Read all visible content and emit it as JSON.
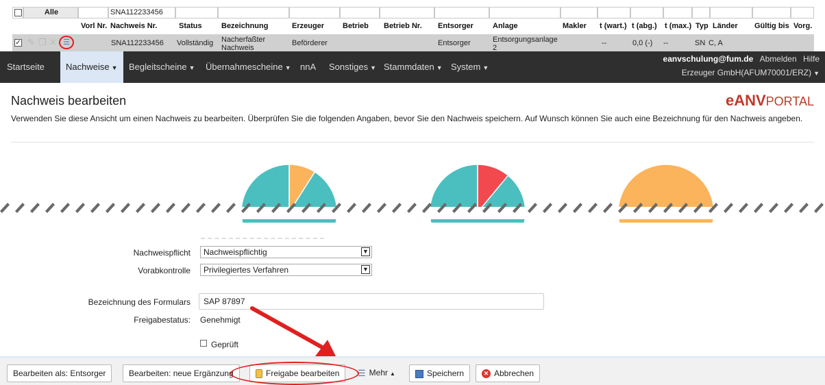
{
  "table": {
    "filter_row": {
      "alle_label": "Alle",
      "nachweis_filter": "SNA112233456"
    },
    "headers": [
      "Vorl Nr.",
      "Nachweis Nr.",
      "Status",
      "Bezeichnung",
      "Erzeuger",
      "Betrieb",
      "Betrieb Nr.",
      "Entsorger",
      "Anlage",
      "Makler",
      "t (wart.)",
      "t (abg.)",
      "t (max.)",
      "Typ",
      "Länder",
      "Gültig bis",
      "Vorg."
    ],
    "row": {
      "nachweis_nr": "SNA112233456",
      "status": "Vollständig",
      "bezeichnung": "Nacherfaßter Nachweis",
      "erzeuger": "Beförderer",
      "entsorger": "Entsorger",
      "anlage": "Entsorgungsanlage 2",
      "t_wart": "--",
      "t_abg": "0,0 (-)",
      "t_max": "--",
      "typ": "SN",
      "laender": "C, A"
    }
  },
  "nav": {
    "items": [
      {
        "label": "Startseite"
      },
      {
        "label": "Nachweise",
        "active": true
      },
      {
        "label": "Begleitscheine"
      },
      {
        "label": "Übernahmescheine"
      },
      {
        "label": "nnA"
      },
      {
        "label": "Sonstiges"
      },
      {
        "label": "Stammdaten"
      },
      {
        "label": "System"
      }
    ],
    "user_email": "eanvschulung@fum.de",
    "logout": "Abmelden",
    "help": "Hilfe",
    "company": "Erzeuger GmbH(AFUM70001/ERZ)"
  },
  "page": {
    "title": "Nachweis bearbeiten",
    "logo_bold": "eANV",
    "logo_thin": "PORTAL",
    "description": "Verwenden Sie diese Ansicht um einen Nachweis zu bearbeiten. Überprüfen Sie die folgenden Angaben, bevor Sie den Nachweis speichern. Auf Wunsch können Sie auch eine Bezeichnung für den Nachweis angeben."
  },
  "charts": {
    "colors": {
      "teal": "#4bbfbf",
      "orange": "#fbb45c",
      "red": "#f2494f"
    },
    "pies": [
      {
        "slices": [
          {
            "color": "orange",
            "fraction": 0.09
          },
          {
            "color": "teal",
            "fraction": 0.91
          }
        ]
      },
      {
        "slices": [
          {
            "color": "red",
            "fraction": 0.11
          },
          {
            "color": "teal",
            "fraction": 0.89
          }
        ]
      },
      {
        "slices": [
          {
            "color": "orange",
            "fraction": 1.0
          }
        ]
      }
    ]
  },
  "form": {
    "nachweispflicht_label": "Nachweispflicht",
    "nachweispflicht_value": "Nachweispflichtig",
    "vorabkontrolle_label": "Vorabkontrolle",
    "vorabkontrolle_value": "Privilegiertes Verfahren",
    "bezeichnung_label": "Bezeichnung des Formulars",
    "bezeichnung_value": "SAP 87897",
    "freigabestatus_label": "Freigabestatus:",
    "freigabestatus_value": "Genehmigt",
    "geprueft_label": "Geprüft",
    "geprueft_checked": false
  },
  "toolbar": {
    "edit_as": "Bearbeiten als: Entsorger",
    "edit_new": "Bearbeiten: neue Ergänzung",
    "freigabe": "Freigabe bearbeiten",
    "mehr": "Mehr",
    "speichern": "Speichern",
    "abbrechen": "Abbrechen"
  },
  "annotation_color": "#e02020"
}
